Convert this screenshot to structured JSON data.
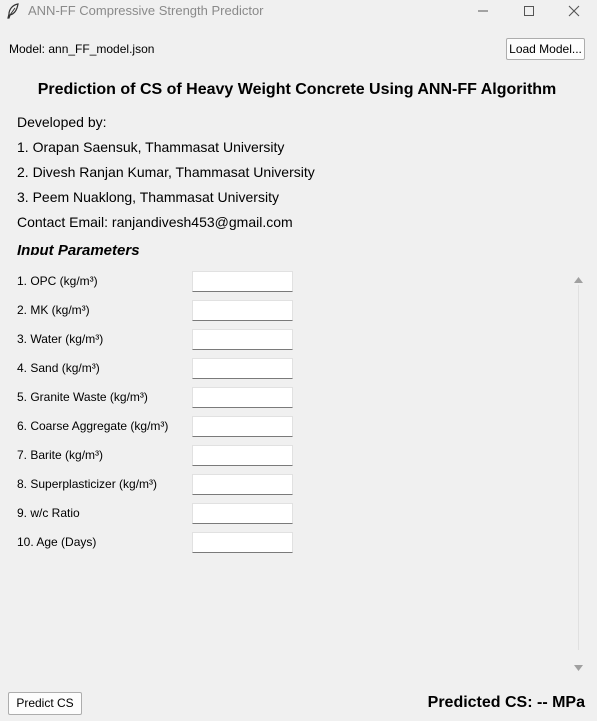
{
  "window": {
    "title": "ANN-FF Compressive Strength Predictor",
    "icons": [
      "feather-icon",
      "minimize-icon",
      "maximize-icon",
      "close-icon"
    ]
  },
  "model": {
    "label": "Model: ann_FF_model.json",
    "load_button": "Load Model..."
  },
  "heading": "Prediction of CS of Heavy Weight Concrete Using ANN-FF Algorithm",
  "credits": {
    "developed_by": "Developed by:",
    "authors": [
      "1. Orapan Saensuk, Thammasat University",
      "2. Divesh Ranjan Kumar, Thammasat University",
      "3. Peem Nuaklong, Thammasat University"
    ],
    "contact": "Contact Email: ranjandivesh453@gmail.com"
  },
  "params": {
    "title": "Input Parameters",
    "fields": [
      {
        "label": "1. OPC (kg/m³)",
        "value": ""
      },
      {
        "label": "2. MK (kg/m³)",
        "value": ""
      },
      {
        "label": "3. Water (kg/m³)",
        "value": ""
      },
      {
        "label": "4. Sand (kg/m³)",
        "value": ""
      },
      {
        "label": "5. Granite Waste (kg/m³)",
        "value": ""
      },
      {
        "label": "6. Coarse Aggregate (kg/m³)",
        "value": ""
      },
      {
        "label": "7. Barite (kg/m³)",
        "value": ""
      },
      {
        "label": "8. Superplasticizer (kg/m³)",
        "value": ""
      },
      {
        "label": "9. w/c Ratio",
        "value": ""
      },
      {
        "label": "10. Age (Days)",
        "value": ""
      }
    ]
  },
  "footer": {
    "predict_button": "Predict CS",
    "result": "Predicted CS: -- MPa"
  },
  "colors": {
    "background": "#f0f0f0",
    "title_text": "#8a8a8a",
    "input_bg": "#ffffff"
  }
}
